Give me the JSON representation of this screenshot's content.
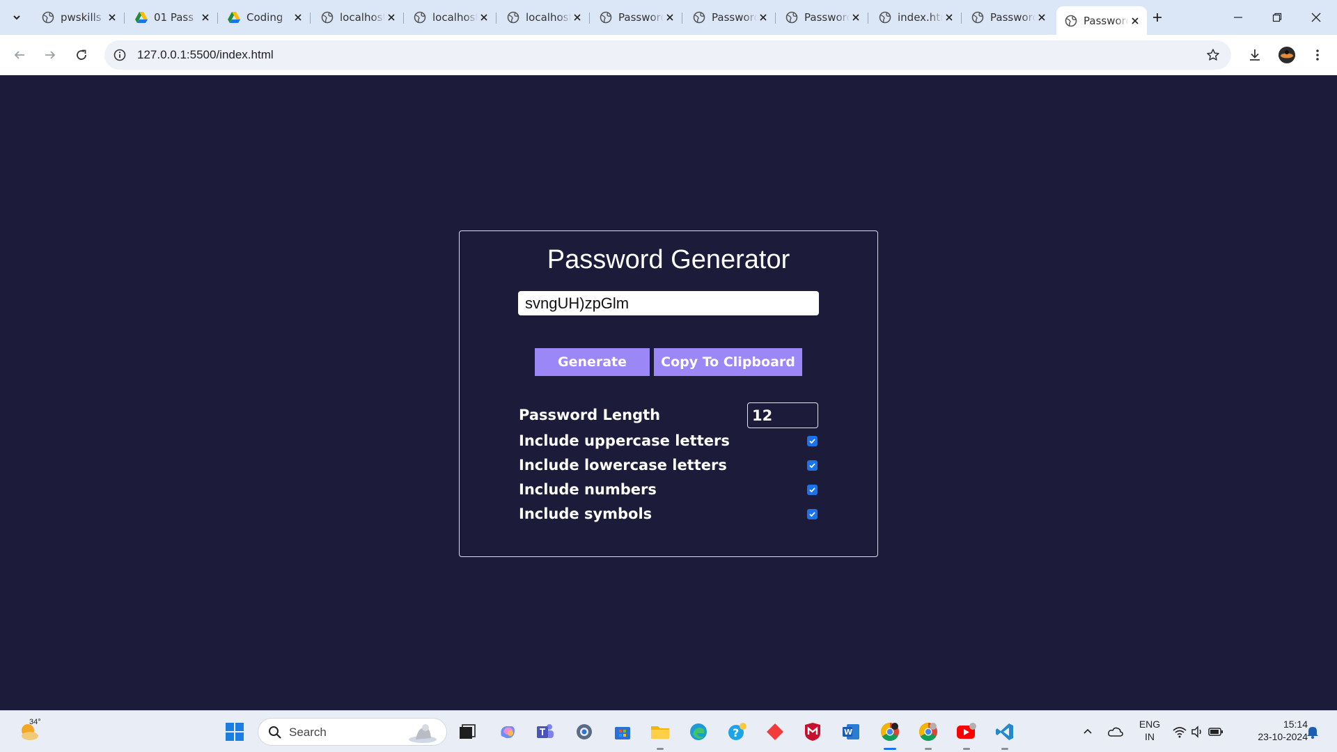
{
  "browser": {
    "tabs": [
      {
        "title": "pwskills",
        "favicon": "globe-icon"
      },
      {
        "title": "01 Pass",
        "favicon": "google-drive-icon"
      },
      {
        "title": "Coding",
        "favicon": "google-drive-icon"
      },
      {
        "title": "localhost",
        "favicon": "globe-icon"
      },
      {
        "title": "localhost",
        "favicon": "globe-icon"
      },
      {
        "title": "localhost",
        "favicon": "globe-icon"
      },
      {
        "title": "Password",
        "favicon": "globe-icon"
      },
      {
        "title": "Password",
        "favicon": "globe-icon"
      },
      {
        "title": "Password",
        "favicon": "globe-icon"
      },
      {
        "title": "index.html",
        "favicon": "globe-icon"
      },
      {
        "title": "Password",
        "favicon": "globe-icon"
      },
      {
        "title": "Password",
        "favicon": "globe-icon",
        "active": true
      }
    ],
    "url": "127.0.0.1:5500/index.html"
  },
  "app": {
    "title": "Password Generator",
    "password": "svngUH)zpGlm",
    "generate_label": "Generate",
    "copy_label": "Copy To Clipboard",
    "length_label": "Password Length",
    "length_value": "12",
    "options": [
      {
        "label": "Include uppercase letters",
        "checked": true
      },
      {
        "label": "Include lowercase letters",
        "checked": true
      },
      {
        "label": "Include numbers",
        "checked": true
      },
      {
        "label": "Include symbols",
        "checked": true
      }
    ],
    "colors": {
      "background": "#1c1b3a",
      "button": "#9b87f5",
      "checkbox": "#1a73e8"
    }
  },
  "taskbar": {
    "weather_temp": "34°",
    "search_placeholder": "Search",
    "language_line1": "ENG",
    "language_line2": "IN",
    "time": "15:14",
    "date": "23-10-2024"
  }
}
